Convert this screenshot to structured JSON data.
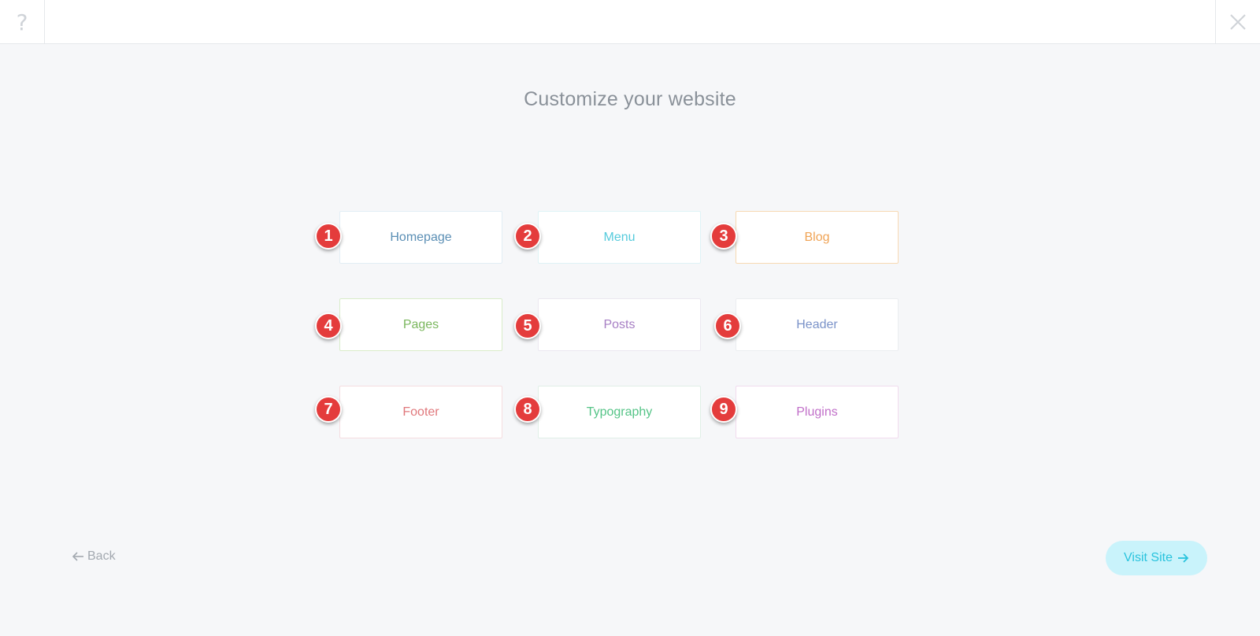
{
  "header": {
    "help_label": "?",
    "close_label": "close"
  },
  "main": {
    "title": "Customize your website",
    "cards": [
      {
        "number": "1",
        "label": "Homepage",
        "color": "#5b8fb5",
        "border": "#e2eef5"
      },
      {
        "number": "2",
        "label": "Menu",
        "color": "#56cbdc",
        "border": "#dff3f6"
      },
      {
        "number": "3",
        "label": "Blog",
        "color": "#f0a456",
        "border": "#f7d9b3"
      },
      {
        "number": "4",
        "label": "Pages",
        "color": "#7bb75e",
        "border": "#d9ecc9"
      },
      {
        "number": "5",
        "label": "Posts",
        "color": "#a77fc4",
        "border": "#ebe8f0"
      },
      {
        "number": "6",
        "label": "Header",
        "color": "#7b93c9",
        "border": "#ebedf0"
      },
      {
        "number": "7",
        "label": "Footer",
        "color": "#e0787c",
        "border": "#f5dde0"
      },
      {
        "number": "8",
        "label": "Typography",
        "color": "#55c487",
        "border": "#e0efe7"
      },
      {
        "number": "9",
        "label": "Plugins",
        "color": "#c16fc9",
        "border": "#f1dbee"
      }
    ]
  },
  "footer": {
    "back_label": "Back",
    "visit_label": "Visit Site"
  },
  "colors": {
    "background": "#f6f7f9",
    "badge": "#e43c3c",
    "visit_button_bg": "#c9f3fb",
    "visit_button_text": "#29c3dd"
  }
}
